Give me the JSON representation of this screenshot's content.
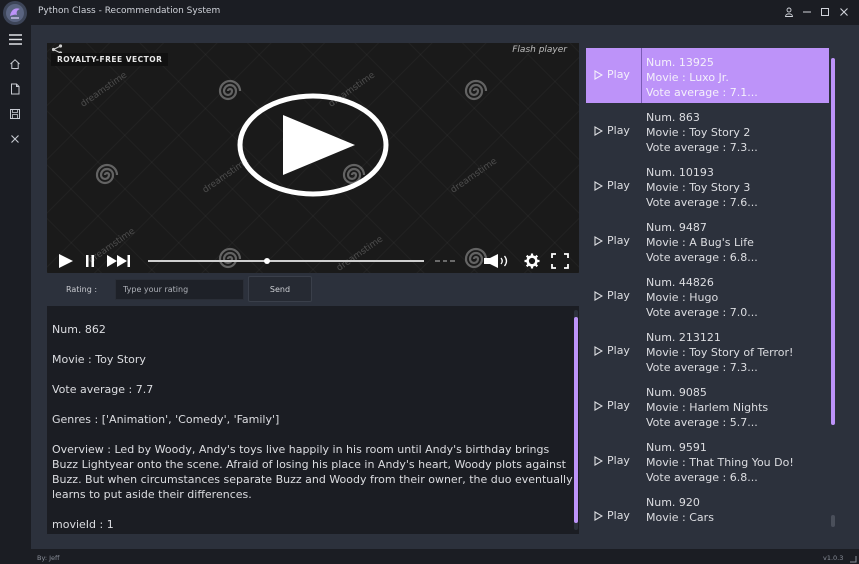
{
  "app": {
    "title": "Python Class - Recommendation System"
  },
  "colors": {
    "accent": "#bd93f9",
    "background": "#2c313c",
    "chrome": "#1b1d23"
  },
  "titlebar_icons": [
    "user-icon",
    "minimize-icon",
    "maximize-icon",
    "close-icon"
  ],
  "sidebar": {
    "items": [
      "menu-icon",
      "home-icon",
      "file-icon",
      "save-icon",
      "close-icon"
    ]
  },
  "video": {
    "overlay_label": "ROYALTY-FREE VECTOR",
    "flash_label": "Flash player",
    "watermark": "dreamstime",
    "progress": 0.43
  },
  "rating": {
    "label": "Rating :",
    "placeholder": "Type your rating",
    "send_label": "Send"
  },
  "info": {
    "num": "Num. 862",
    "movie": "Movie : Toy Story",
    "vote": "Vote average : 7.7",
    "genres": "Genres : ['Animation', 'Comedy', 'Family']",
    "overview": "Overview : Led by Woody, Andy's toys live happily in his room until Andy's birthday brings Buzz Lightyear onto the scene. Afraid of losing his place in Andy's heart, Woody plots against Buzz. But when circumstances separate Buzz and Woody from their owner, the duo eventually learns to put aside their differences.",
    "movieid": "movieId : 1"
  },
  "movies": [
    {
      "play": "Play",
      "num": "Num. 13925",
      "movie": "Movie : Luxo Jr.",
      "vote": "Vote average : 7.1..."
    },
    {
      "play": "Play",
      "num": "Num. 863",
      "movie": "Movie : Toy Story 2",
      "vote": "Vote average : 7.3..."
    },
    {
      "play": "Play",
      "num": "Num. 10193",
      "movie": "Movie : Toy Story 3",
      "vote": "Vote average : 7.6..."
    },
    {
      "play": "Play",
      "num": "Num. 9487",
      "movie": "Movie : A Bug's Life",
      "vote": "Vote average : 6.8..."
    },
    {
      "play": "Play",
      "num": "Num. 44826",
      "movie": "Movie : Hugo",
      "vote": "Vote average : 7.0..."
    },
    {
      "play": "Play",
      "num": "Num. 213121",
      "movie": "Movie : Toy Story of Terror!",
      "vote": "Vote average : 7.3..."
    },
    {
      "play": "Play",
      "num": "Num. 9085",
      "movie": "Movie : Harlem Nights",
      "vote": "Vote average : 5.7..."
    },
    {
      "play": "Play",
      "num": "Num. 9591",
      "movie": "Movie : That Thing You Do!",
      "vote": "Vote average : 6.8..."
    },
    {
      "play": "Play",
      "num": "Num. 920",
      "movie": "Movie : Cars",
      "vote": ""
    }
  ],
  "footer": {
    "credit": "By: Jeff",
    "version": "v1.0.3"
  }
}
